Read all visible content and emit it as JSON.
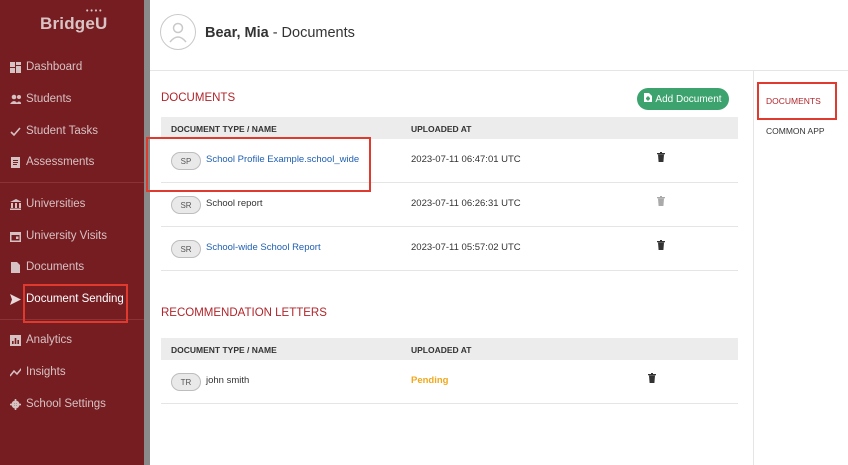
{
  "sidebar": {
    "logo": "BridgeU",
    "items": [
      {
        "label": "Dashboard",
        "icon": "dashboard-icon"
      },
      {
        "label": "Students",
        "icon": "students-icon"
      },
      {
        "label": "Student Tasks",
        "icon": "tasks-icon"
      },
      {
        "label": "Assessments",
        "icon": "assessments-icon"
      },
      {
        "label": "Universities",
        "icon": "university-icon"
      },
      {
        "label": "University Visits",
        "icon": "calendar-icon"
      },
      {
        "label": "Documents",
        "icon": "document-icon"
      },
      {
        "label": "Document Sending",
        "icon": "send-icon"
      },
      {
        "label": "Analytics",
        "icon": "analytics-icon"
      },
      {
        "label": "Insights",
        "icon": "insights-icon"
      },
      {
        "label": "School Settings",
        "icon": "gear-icon"
      }
    ]
  },
  "header": {
    "student_name": "Bear, Mia",
    "title_suffix": " - Documents"
  },
  "documents": {
    "title": "DOCUMENTS",
    "add_button": "Add Document",
    "col_type": "DOCUMENT TYPE / NAME",
    "col_uploaded": "UPLOADED AT",
    "rows": [
      {
        "badge": "SP",
        "name": "School Profile Example.school_wide",
        "uploaded": "2023-07-11 06:47:01 UTC",
        "link": true
      },
      {
        "badge": "SR",
        "name": "School report",
        "uploaded": "2023-07-11 06:26:31 UTC",
        "link": false
      },
      {
        "badge": "SR",
        "name": "School-wide School Report",
        "uploaded": "2023-07-11 05:57:02 UTC",
        "link": true
      }
    ]
  },
  "recommendations": {
    "title": "RECOMMENDATION LETTERS",
    "col_type": "DOCUMENT TYPE / NAME",
    "col_uploaded": "UPLOADED AT",
    "rows": [
      {
        "badge": "TR",
        "name": "john smith",
        "uploaded": "Pending"
      }
    ]
  },
  "right_nav": {
    "items": [
      "DOCUMENTS",
      "COMMON APP"
    ]
  },
  "colors": {
    "sidebar_bg": "#761d22",
    "accent_red": "#b0252b",
    "button_green": "#3da36e",
    "pending_orange": "#f0a81c",
    "link_blue": "#1f5fb3",
    "highlight_box": "#e03a2f"
  }
}
